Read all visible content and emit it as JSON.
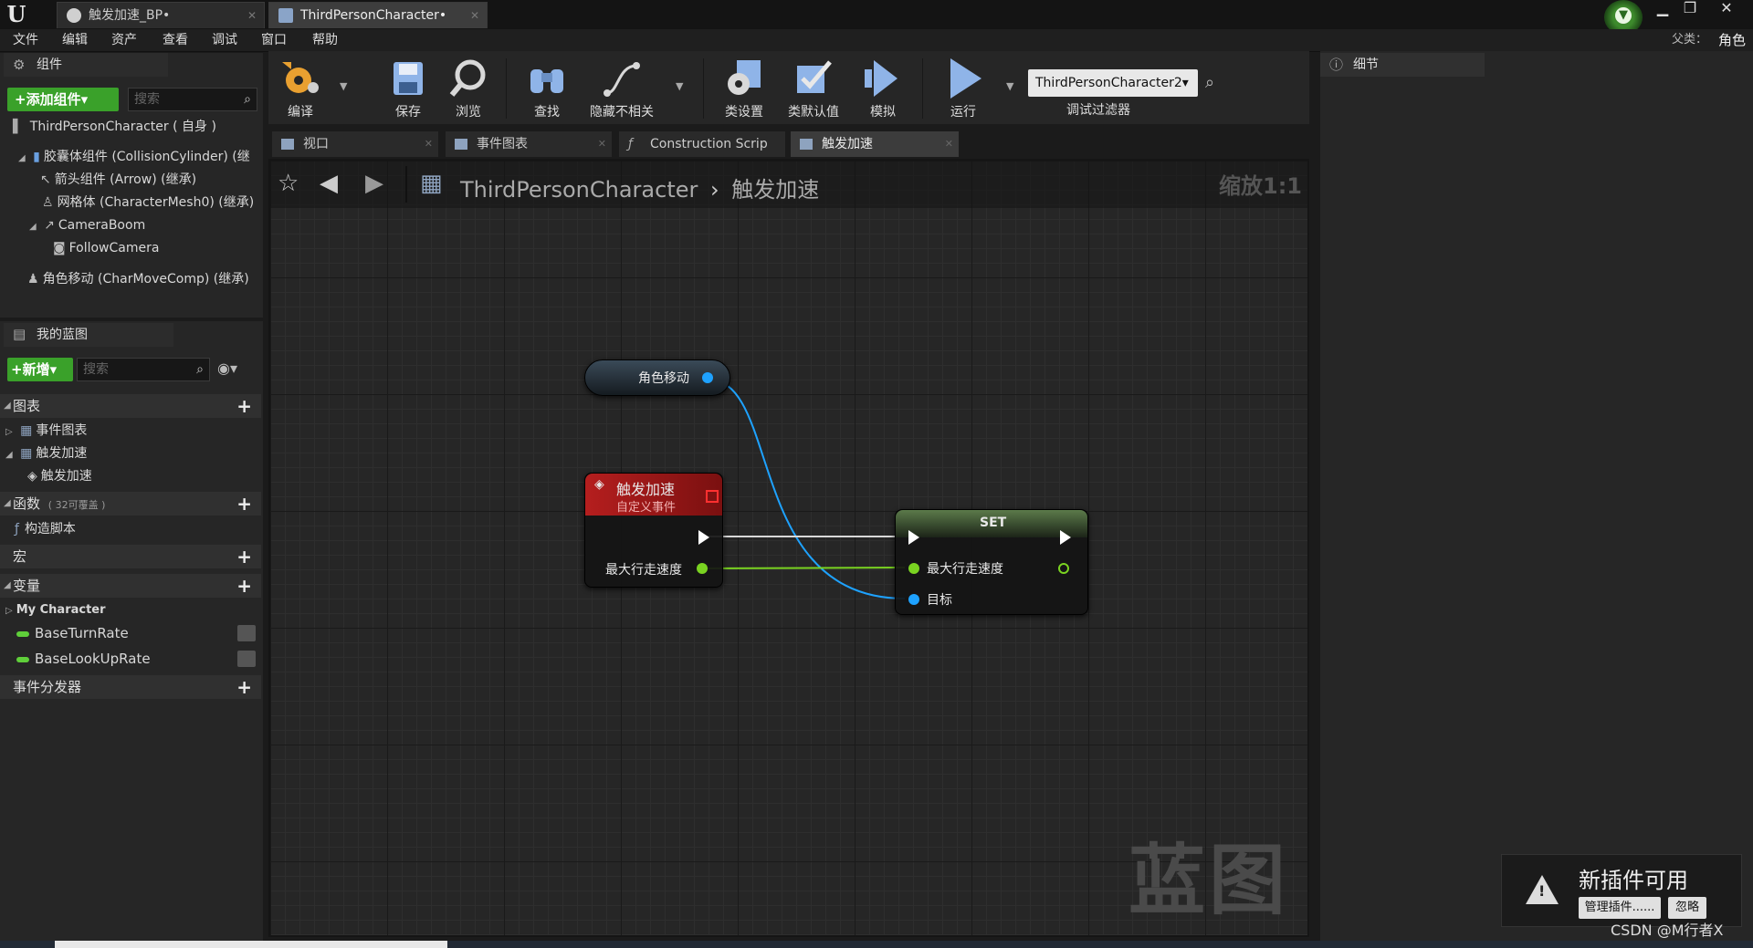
{
  "titlebar": {
    "tabs": [
      {
        "label": "触发加速_BP•",
        "active": false
      },
      {
        "label": "ThirdPersonCharacter•",
        "active": true
      }
    ]
  },
  "menu": [
    "文件",
    "编辑",
    "资产",
    "查看",
    "调试",
    "窗口",
    "帮助"
  ],
  "parent_class": {
    "label": "父类：",
    "value": "角色"
  },
  "components_panel": {
    "title": "组件",
    "add_button": "+添加组件▾",
    "search_placeholder": "搜索",
    "root": "ThirdPersonCharacter ( 自身 )",
    "tree": [
      "胶囊体组件 (CollisionCylinder) (继",
      "箭头组件 (Arrow) (继承)",
      "网格体 (CharacterMesh0) (继承)",
      "CameraBoom",
      "FollowCamera",
      "角色移动 (CharMoveComp) (继承)"
    ]
  },
  "my_blueprint": {
    "title": "我的蓝图",
    "new_button": "+新增▾",
    "search_placeholder": "搜索",
    "sections": {
      "graphs": "图表",
      "event_graph": "事件图表",
      "trigger_graph": "触发加速",
      "trigger_event": "触发加速",
      "functions": "函数",
      "functions_note": "( 32可覆盖 )",
      "construction": "构造脚本",
      "macros": "宏",
      "variables": "变量",
      "var_category": "My Character",
      "var1": "BaseTurnRate",
      "var2": "BaseLookUpRate",
      "dispatchers": "事件分发器"
    }
  },
  "toolbar": {
    "compile": "编译",
    "save": "保存",
    "browse": "浏览",
    "find": "查找",
    "hide_unrelated": "隐藏不相关",
    "class_settings": "类设置",
    "class_defaults": "类默认值",
    "simulate": "模拟",
    "play": "运行",
    "debug_target": "ThirdPersonCharacter2▾",
    "debug_filter": "调试过滤器"
  },
  "graph_tabs": [
    {
      "label": "视口",
      "active": false
    },
    {
      "label": "事件图表",
      "active": false
    },
    {
      "label": "Construction Scrip",
      "active": false
    },
    {
      "label": "触发加速",
      "active": true
    }
  ],
  "graph": {
    "breadcrumb_root": "ThirdPersonCharacter",
    "breadcrumb_sep": "›",
    "breadcrumb_current": "触发加速",
    "zoom": "缩放1:1",
    "watermark": "蓝图",
    "nodes": {
      "var_node": "角色移动",
      "event_title": "触发加速",
      "event_subtitle": "自定义事件",
      "event_param": "最大行走速度",
      "set_title": "SET",
      "set_in": "最大行走速度",
      "set_target": "目标"
    }
  },
  "details": {
    "title": "细节"
  },
  "notification": {
    "title": "新插件可用",
    "manage": "管理插件......",
    "ignore": "忽略"
  },
  "credit": "CSDN @M行者X",
  "colors": {
    "accent_green": "#3aa12a",
    "object_pin": "#1ea2ff",
    "float_pin": "#7ad321",
    "event_header": "#b51e1e"
  }
}
